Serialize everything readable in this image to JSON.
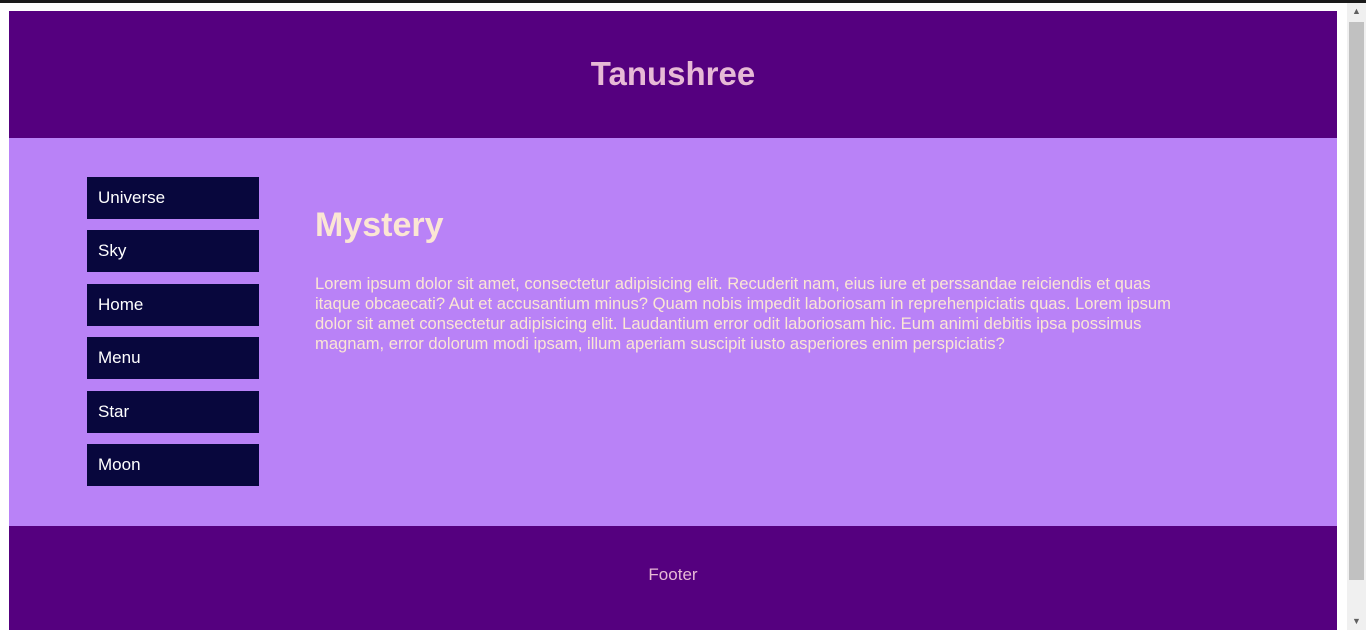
{
  "header": {
    "title": "Tanushree"
  },
  "nav": {
    "items": [
      {
        "label": "Universe"
      },
      {
        "label": "Sky"
      },
      {
        "label": "Home"
      },
      {
        "label": "Menu"
      },
      {
        "label": "Star"
      },
      {
        "label": "Moon"
      }
    ]
  },
  "article": {
    "title": "Mystery",
    "body": "Lorem ipsum dolor sit amet, consectetur adipisicing elit. Recuderit nam, eius iure et perssandae reiciendis et quas itaque obcaecati? Aut et accusantium minus? Quam nobis impedit laboriosam in reprehenpiciatis quas. Lorem ipsum dolor sit amet consectetur adipisicing elit. Laudantium error odit laboriosam hic. Eum animi debitis ipsa possimus magnam, error dolorum modi ipsam, illum aperiam suscipit iusto asperiores enim perspiciatis?"
  },
  "footer": {
    "text": "Footer"
  },
  "scrollbar": {
    "up_icon": "chevron-up-icon",
    "down_icon": "chevron-down-icon"
  },
  "colors": {
    "header_bg": "#55007f",
    "main_bg": "#b982f7",
    "nav_bg": "#08073d",
    "title_text": "#e7b9d6",
    "article_text": "#fbe6d4"
  }
}
